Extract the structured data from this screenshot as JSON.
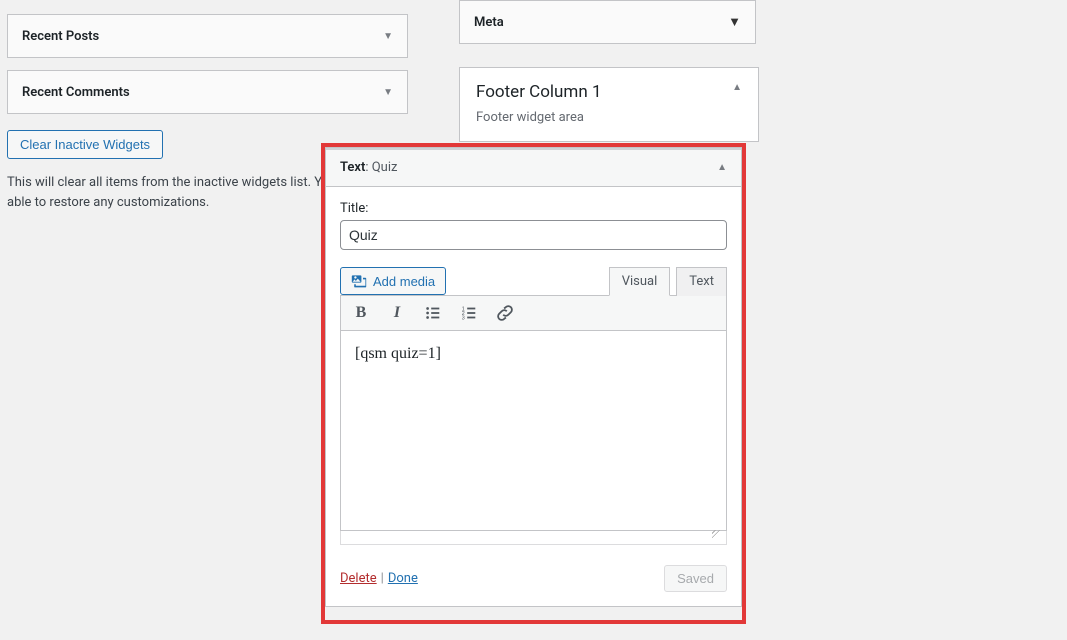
{
  "left": {
    "widgets": [
      {
        "label": "Recent Posts"
      },
      {
        "label": "Recent Comments"
      }
    ],
    "clear_button": "Clear Inactive Widgets",
    "description": "This will clear all items from the inactive widgets list. You will not be able to restore any customizations."
  },
  "right": {
    "meta_label": "Meta",
    "footer": {
      "title": "Footer Column 1",
      "desc": "Footer widget area"
    }
  },
  "text_widget": {
    "header_prefix": "Text",
    "header_suffix": ": Quiz",
    "title_label": "Title:",
    "title_value": "Quiz",
    "add_media": "Add media",
    "tabs": {
      "visual": "Visual",
      "text": "Text"
    },
    "toolbar": [
      "bold",
      "italic",
      "bullet-list",
      "numbered-list",
      "link"
    ],
    "content": "[qsm quiz=1]",
    "footer": {
      "delete": "Delete",
      "done": "Done",
      "saved": "Saved"
    }
  }
}
